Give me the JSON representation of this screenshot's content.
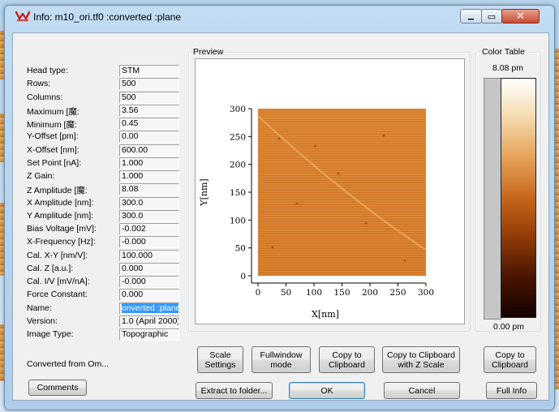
{
  "window": {
    "title": "Info: m10_ori.tf0 :converted :plane",
    "minimize_symbol": "▁",
    "maximize_symbol": "▭",
    "close_symbol": "✕"
  },
  "info": {
    "fields": [
      {
        "label": "Head type:",
        "value": "STM"
      },
      {
        "label": "Rows:",
        "value": "500"
      },
      {
        "label": "Columns:",
        "value": "500"
      },
      {
        "label": "Maximum [魔:",
        "value": "3.56"
      },
      {
        "label": "Minimum [魔:",
        "value": "0.45"
      },
      {
        "label": "Y-Offset [pm]:",
        "value": "0.00"
      },
      {
        "label": "X-Offset [nm]:",
        "value": "600.00"
      },
      {
        "label": "Set Point [nA]:",
        "value": "1.000"
      },
      {
        "label": "Z Gain:",
        "value": "1.000"
      },
      {
        "label": "Z Amplitude [魔:",
        "value": "8.08"
      },
      {
        "label": "X Amplitude [nm]:",
        "value": "300.0"
      },
      {
        "label": "Y Amplitude [nm]:",
        "value": "300.0"
      },
      {
        "label": "Bias Voltage [mV]:",
        "value": "-0.002"
      },
      {
        "label": "X-Frequency [Hz]:",
        "value": "-0.000"
      },
      {
        "label": "Cal. X-Y [nm/V]:",
        "value": "100.000"
      },
      {
        "label": "Cal. Z [a.u.]:",
        "value": "0.000"
      },
      {
        "label": "Cal. I/V [mV/nA]:",
        "value": "-0.000"
      },
      {
        "label": "Force Constant:",
        "value": "0.000"
      },
      {
        "label": "Name:",
        "value": "onverted :plane"
      },
      {
        "label": "Version:",
        "value": "1.0 (April 2000)"
      },
      {
        "label": "Image Type:",
        "value": "Topographic"
      }
    ],
    "converted_from": "Converted from Om...",
    "comments_button": "Comments"
  },
  "preview": {
    "group_label": "Preview",
    "xlabel": "X[nm]",
    "ylabel": "Y[nm]",
    "x_ticks": [
      "0",
      "50",
      "100",
      "150",
      "200",
      "250",
      "300"
    ],
    "y_ticks": [
      "300",
      "250",
      "200",
      "150",
      "100",
      "50",
      "0"
    ],
    "colors": {
      "image_base": "#d77d2a",
      "image_light": "#e8a452",
      "image_dark": "#c46c1f"
    }
  },
  "color_table": {
    "group_label": "Color Table",
    "max_label": "8.08 pm",
    "min_label": "0.00 pm",
    "colors": [
      "#ffffff",
      "#f3d8a8",
      "#e6a25a",
      "#c7661c",
      "#8e3a06",
      "#4a1401",
      "#120300"
    ]
  },
  "buttons": {
    "scale_settings": "Scale\nSettings",
    "fullwindow_mode": "Fullwindow\nmode",
    "copy_to_clipboard": "Copy to\nClipboard",
    "copy_with_z_scale": "Copy to Clipboard\nwith Z Scale",
    "copy_to_clipboard_ct": "Copy to\nClipboard",
    "extract_to_folder": "Extract to folder...",
    "ok": "OK",
    "cancel": "Cancel",
    "full_info": "Full Info"
  },
  "chart_data": {
    "type": "heatmap",
    "xlabel": "X[nm]",
    "ylabel": "Y[nm]",
    "xlim": [
      0,
      300
    ],
    "ylim": [
      0,
      300
    ],
    "x_ticks": [
      0,
      50,
      100,
      150,
      200,
      250,
      300
    ],
    "y_ticks": [
      0,
      50,
      100,
      150,
      200,
      250,
      300
    ],
    "colorbar": {
      "min": "0.00 pm",
      "max": "8.08 pm"
    }
  }
}
